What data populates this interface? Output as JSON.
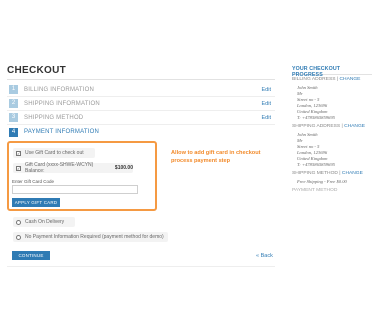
{
  "checkout": {
    "title": "CHECKOUT",
    "steps": [
      {
        "num": "1",
        "label": "BILLING INFORMATION",
        "edit": "Edit"
      },
      {
        "num": "2",
        "label": "SHIPPING INFORMATION",
        "edit": "Edit"
      },
      {
        "num": "3",
        "label": "SHIPPING METHOD",
        "edit": "Edit"
      },
      {
        "num": "4",
        "label": "PAYMENT INFORMATION",
        "edit": ""
      }
    ]
  },
  "payment": {
    "use_gift_card": "Use Gift Card to check out",
    "gift_card_text": "Gift Card (xxxx-SHWE-WCYN) Balance:",
    "gift_card_balance": "$100.00",
    "code_label": "Enter Gift Card Code",
    "code_value": "",
    "apply_button": "APPLY GIFT CARD",
    "cash_on_delivery": "Cash On Delivery",
    "no_payment": "No Payment Information Required (payment method for demo)",
    "continue_button": "CONTINUE",
    "back_link": "« Back"
  },
  "annotation": "Allow to add gift card in checkout process payment step",
  "sidebar": {
    "title": "YOUR CHECKOUT PROGRESS",
    "billing_head": "BILLING ADDRESS",
    "shipping_head": "SHIPPING ADDRESS",
    "method_head": "SHIPPING METHOD",
    "payment_head": "PAYMENT METHOD",
    "change": "CHANGE",
    "separator": " | ",
    "billing_address": [
      "John Smith",
      "Mr",
      "Street no - 5",
      "London, 123696",
      "United Kingdom",
      "T: +4785865859695"
    ],
    "shipping_address": [
      "John Smith",
      "Mr",
      "Street no - 5",
      "London, 123696",
      "United Kingdom",
      "T: +4785865859695"
    ],
    "shipping_method": "Free Shipping - Free $0.00"
  },
  "colors": {
    "accent": "#2f7bb4",
    "highlight": "#f59a43",
    "annotation": "#f28a2a"
  }
}
